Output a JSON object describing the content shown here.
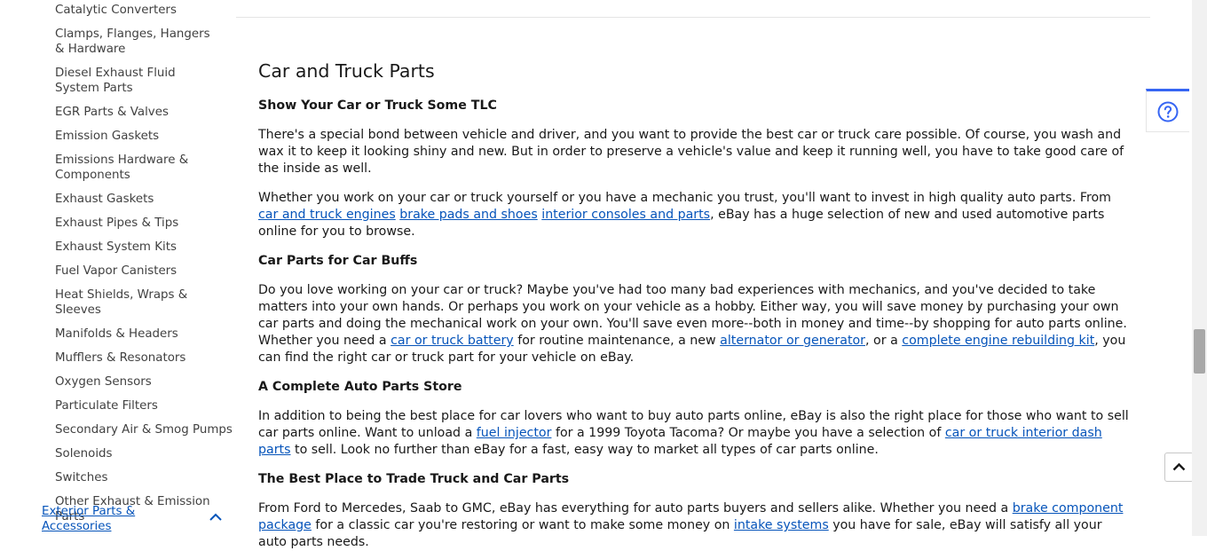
{
  "sidebar": {
    "items": [
      {
        "label": "Catalytic Converters"
      },
      {
        "label": "Clamps, Flanges, Hangers & Hardware"
      },
      {
        "label": "Diesel Exhaust Fluid System Parts"
      },
      {
        "label": "EGR Parts & Valves"
      },
      {
        "label": "Emission Gaskets"
      },
      {
        "label": "Emissions Hardware & Components"
      },
      {
        "label": "Exhaust Gaskets"
      },
      {
        "label": "Exhaust Pipes & Tips"
      },
      {
        "label": "Exhaust System Kits"
      },
      {
        "label": "Fuel Vapor Canisters"
      },
      {
        "label": "Heat Shields, Wraps & Sleeves"
      },
      {
        "label": "Manifolds & Headers"
      },
      {
        "label": "Mufflers & Resonators"
      },
      {
        "label": "Oxygen Sensors"
      },
      {
        "label": "Particulate Filters"
      },
      {
        "label": "Secondary Air & Smog Pumps"
      },
      {
        "label": "Solenoids"
      },
      {
        "label": "Switches"
      },
      {
        "label": "Other Exhaust & Emission Parts"
      }
    ],
    "parent_category": "Exterior Parts & Accessories",
    "parent_icon": "chevron-up-icon"
  },
  "content": {
    "title": "Car and Truck Parts",
    "sections": [
      {
        "heading": "Show Your Car or Truck Some TLC",
        "p1": "There's a special bond between vehicle and driver, and you want to provide the best car or truck care possible. Of course, you wash and wax it to keep it looking shiny and new. But in order to preserve a vehicle's value and keep it running well, you have to take good care of the inside as well.",
        "p2": {
          "t1": "Whether you work on your car or truck yourself or you have a mechanic you trust, you'll want to invest in high quality auto parts. From ",
          "l1": "car and truck engines",
          "t2": " ",
          "l2": "brake pads and shoes",
          "t3": " ",
          "l3": "interior consoles and parts",
          "t4": ", eBay has a huge selection of new and used automotive parts online for you to browse."
        }
      },
      {
        "heading": "Car Parts for Car Buffs",
        "p1": {
          "t1": "Do you love working on your car or truck? Maybe you've had too many bad experiences with mechanics, and you've decided to take matters into your own hands. Or perhaps you work on your vehicle as a hobby. Either way, you will save money by purchasing your own car parts and doing the mechanical work on your own. You'll save even more--both in money and time--by shopping for auto parts online. Whether you need a ",
          "l1": "car or truck battery",
          "t2": " for routine maintenance, a new ",
          "l2": "alternator or generator",
          "t3": ", or a ",
          "l3": "complete engine rebuilding kit",
          "t4": ", you can find the right car or truck part for your vehicle on eBay."
        }
      },
      {
        "heading": "A Complete Auto Parts Store",
        "p1": {
          "t1": "In addition to being the best place for car lovers who want to buy auto parts online, eBay is also the right place for those who want to sell car parts online. Want to unload a ",
          "l1": "fuel injector",
          "t2": " for a 1999 Toyota Tacoma? Or maybe you have a selection of ",
          "l2": "car or truck interior dash parts",
          "t3": " to sell. Look no further than eBay for a fast, easy way to market all types of car parts online."
        }
      },
      {
        "heading": "The Best Place to Trade Truck and Car Parts",
        "p1": {
          "t1": "From Ford to Mercedes, Saab to GMC, eBay has everything for auto parts buyers and sellers alike. Whether you need a ",
          "l1": "brake component package",
          "t2": " for a classic car you're restoring or want to make some money on ",
          "l2": "intake systems",
          "t3": " you have for sale, eBay will satisfy all your auto parts needs."
        }
      }
    ]
  },
  "widgets": {
    "help_icon": "help-circle-icon",
    "back_to_top_icon": "chevron-up-icon"
  },
  "colors": {
    "link": "#0654ba",
    "accent": "#3665f3",
    "text": "#191919"
  }
}
